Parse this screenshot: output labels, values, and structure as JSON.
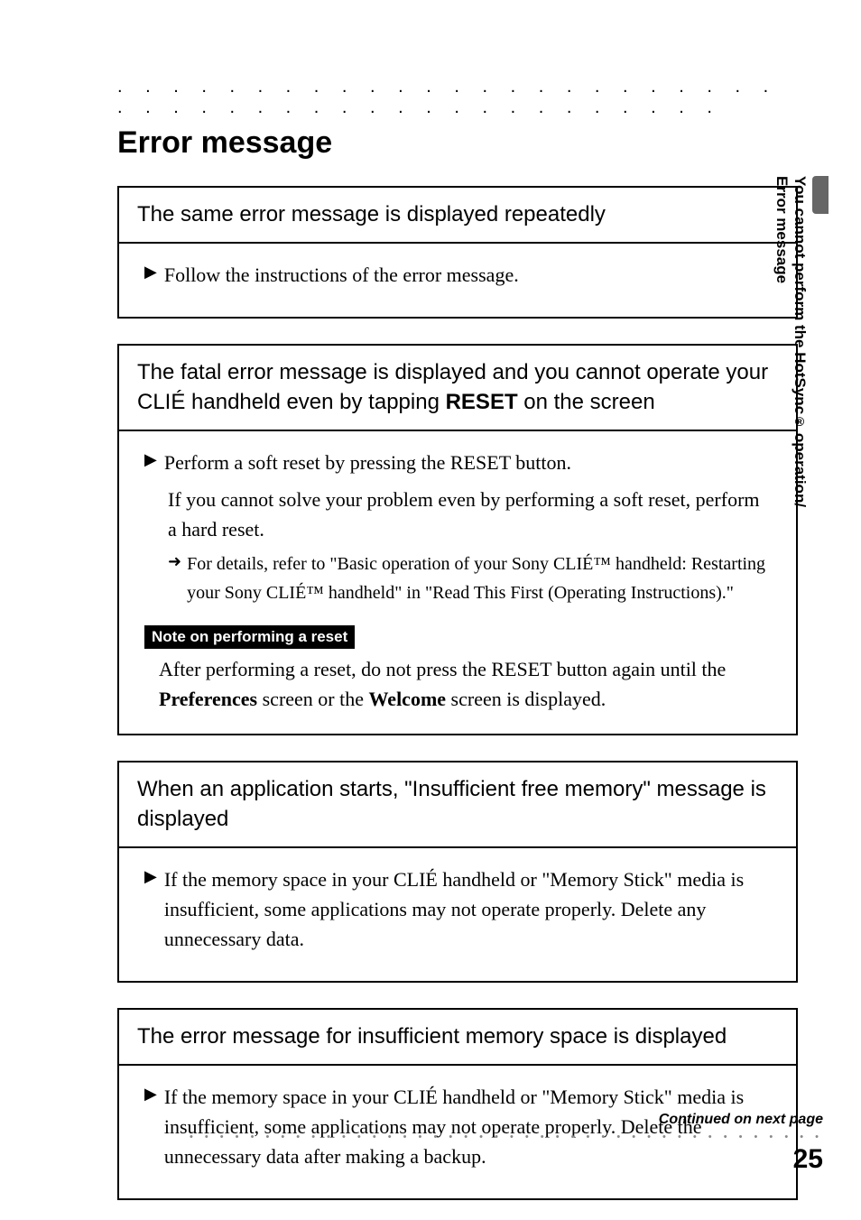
{
  "heading": "Error message",
  "sidebar": {
    "line1": "You cannot perform the HotSync",
    "reg": "®",
    "line1b": " operation/",
    "line2": "Error message"
  },
  "panels": [
    {
      "title": "The same error message is displayed repeatedly",
      "bullets": [
        {
          "text": "Follow the instructions of the error message."
        }
      ]
    },
    {
      "title_pre": "The fatal error message is displayed and you cannot operate your CLIÉ handheld even by tapping ",
      "title_bold": "RESET",
      "title_post": " on the screen",
      "bullets": [
        {
          "text": "Perform a soft reset by pressing the RESET button.",
          "sub": "If you cannot solve your problem even by performing a soft reset, perform a hard reset.",
          "arrow": "For details, refer to \"Basic operation of your Sony CLIÉ™ handheld: Restarting your Sony CLIÉ™ handheld\" in \"Read This First (Operating Instructions).\""
        }
      ],
      "note_label": "Note on performing a reset",
      "note_pre": "After performing a reset, do not press the RESET button again until the ",
      "note_b1": "Preferences",
      "note_mid": " screen or the ",
      "note_b2": "Welcome",
      "note_post": " screen is displayed."
    },
    {
      "title": "When an application starts, \"Insufficient free memory\" message is displayed",
      "bullets": [
        {
          "text": "If the memory space in your CLIÉ handheld or \"Memory Stick\" media is insufficient, some applications may not operate properly. Delete any unnecessary data."
        }
      ]
    },
    {
      "title": "The error message for insufficient memory space is displayed",
      "bullets": [
        {
          "text": "If the memory space in your CLIÉ handheld or \"Memory Stick\" media is insufficient, some applications may not operate properly. Delete the unnecessary data after making a backup."
        }
      ]
    }
  ],
  "footer": {
    "continued": "Continued on next page",
    "page": "25"
  }
}
